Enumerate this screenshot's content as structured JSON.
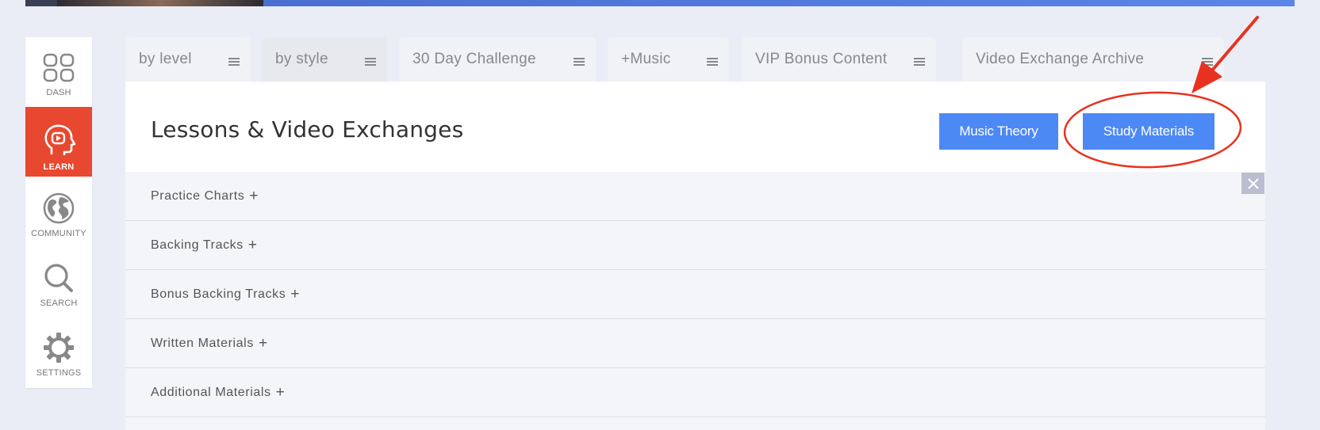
{
  "nav": {
    "items": [
      {
        "label": "DASH",
        "icon": "dashboard-grid-icon"
      },
      {
        "label": "LEARN",
        "icon": "learn-head-icon",
        "active": true
      },
      {
        "label": "COMMUNITY",
        "icon": "globe-icon"
      },
      {
        "label": "SEARCH",
        "icon": "search-icon"
      },
      {
        "label": "SETTINGS",
        "icon": "gear-icon"
      }
    ]
  },
  "tabs": [
    {
      "label": "by level"
    },
    {
      "label": "by style"
    },
    {
      "label": "30 Day Challenge"
    },
    {
      "label": "+Music"
    },
    {
      "label": "VIP Bonus Content"
    },
    {
      "label": "Video Exchange Archive"
    }
  ],
  "panel": {
    "title": "Lessons & Video Exchanges",
    "buttons": {
      "music_theory": "Music Theory",
      "study_materials": "Study Materials"
    },
    "sections": [
      {
        "label": "Practice Charts",
        "symbol": "+"
      },
      {
        "label": "Backing Tracks",
        "symbol": "+"
      },
      {
        "label": "Bonus Backing Tracks",
        "symbol": "+"
      },
      {
        "label": "Written Materials",
        "symbol": "+"
      },
      {
        "label": "Additional Materials",
        "symbol": "+"
      }
    ]
  },
  "colors": {
    "accent_blue": "#4d89f5",
    "nav_active": "#e8482f",
    "annotation_red": "#e8321f",
    "background": "#ebedf6"
  }
}
